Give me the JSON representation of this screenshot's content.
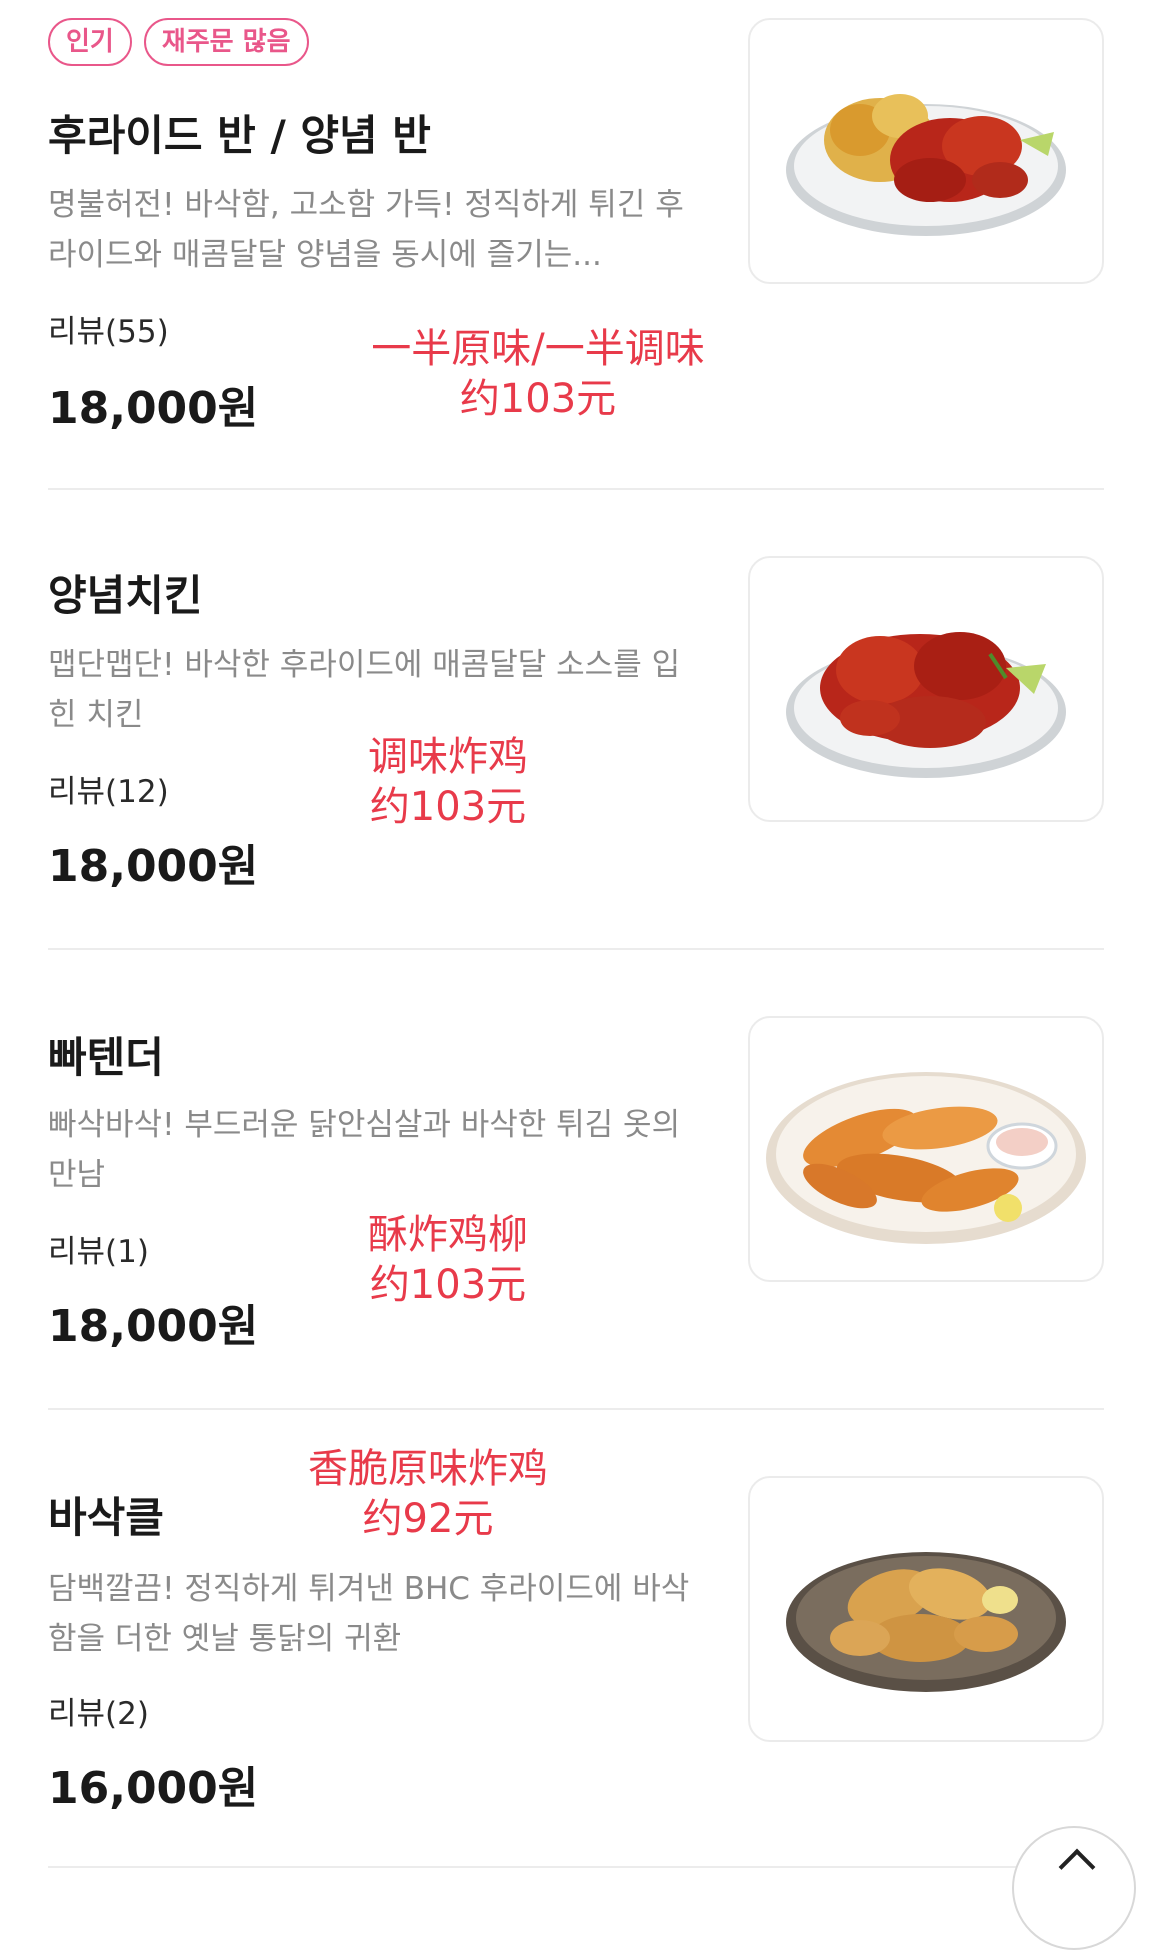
{
  "menu": {
    "items": [
      {
        "badges": [
          "인기",
          "재주문 많음"
        ],
        "name": "후라이드 반 / 양념 반",
        "description": "명불허전! 바삭함, 고소함 가득! 정직하게 튀긴 후라이드와 매콤달달 양념을 동시에 즐기는...",
        "review": "리뷰(55)",
        "price": "18,000원",
        "annotation": {
          "line1": "一半原味/一半调味",
          "line2": "约103元"
        },
        "image_icon": "half-half-chicken-plate-icon"
      },
      {
        "badges": [],
        "name": "양념치킨",
        "description": "맵단맵단! 바삭한 후라이드에 매콤달달 소스를 입힌 치킨",
        "review": "리뷰(12)",
        "price": "18,000원",
        "annotation": {
          "line1": "调味炸鸡",
          "line2": "约103元"
        },
        "image_icon": "seasoned-chicken-plate-icon"
      },
      {
        "badges": [],
        "name": "빠텐더",
        "description": "빠삭바삭! 부드러운 닭안심살과 바삭한 튀김 옷의 만남",
        "review": "리뷰(1)",
        "price": "18,000원",
        "annotation": {
          "line1": "酥炸鸡柳",
          "line2": "约103元"
        },
        "image_icon": "chicken-tenders-plate-icon"
      },
      {
        "badges": [],
        "name": "바삭클",
        "description": "담백깔끔! 정직하게 튀겨낸 BHC 후라이드에 바삭함을 더한 옛날 통닭의 귀환",
        "review": "리뷰(2)",
        "price": "16,000원",
        "annotation": {
          "line1": "香脆原味炸鸡",
          "line2": "约92元"
        },
        "image_icon": "crispy-fried-chicken-plate-icon"
      }
    ]
  },
  "colors": {
    "badge": "#e9578a",
    "annotation": "#e83a4a",
    "description": "#8a8a8a",
    "divider": "#ececec"
  },
  "scroll_top_icon": "chevron-up-icon"
}
